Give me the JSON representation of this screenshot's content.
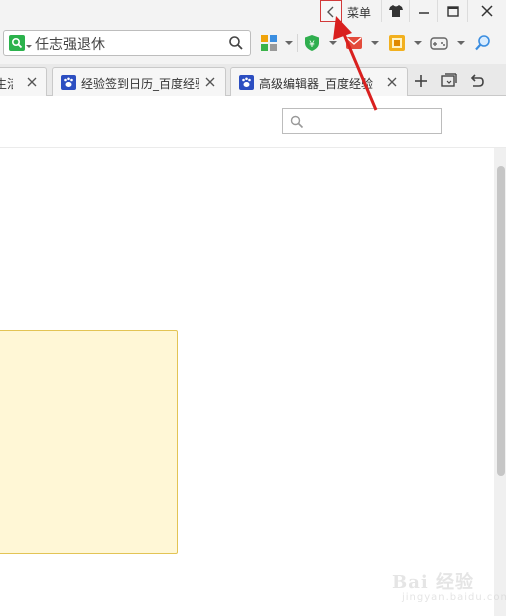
{
  "titlebar": {
    "menu_label": "菜单",
    "buttons": [
      "collapse",
      "skin",
      "minimize",
      "maximize",
      "close"
    ]
  },
  "toolbar": {
    "search_value": "任志强退休",
    "icons": [
      "apps-grid-icon",
      "shield-yuan-icon",
      "mail-icon",
      "extension-icon",
      "game-controller-icon",
      "magnifier-icon"
    ]
  },
  "tabs": [
    {
      "title": "生活",
      "active": false
    },
    {
      "title": "经验签到日历_百度经验",
      "active": false
    },
    {
      "title": "高级编辑器_百度经验",
      "active": true
    }
  ],
  "page": {
    "search_placeholder": ""
  },
  "watermark": {
    "text": "Bai 经验",
    "sub": "jingyan.baidu.com"
  },
  "colors": {
    "annotation_red": "#d9201f",
    "note_fill": "#fff7d6",
    "note_border": "#e3c455"
  }
}
